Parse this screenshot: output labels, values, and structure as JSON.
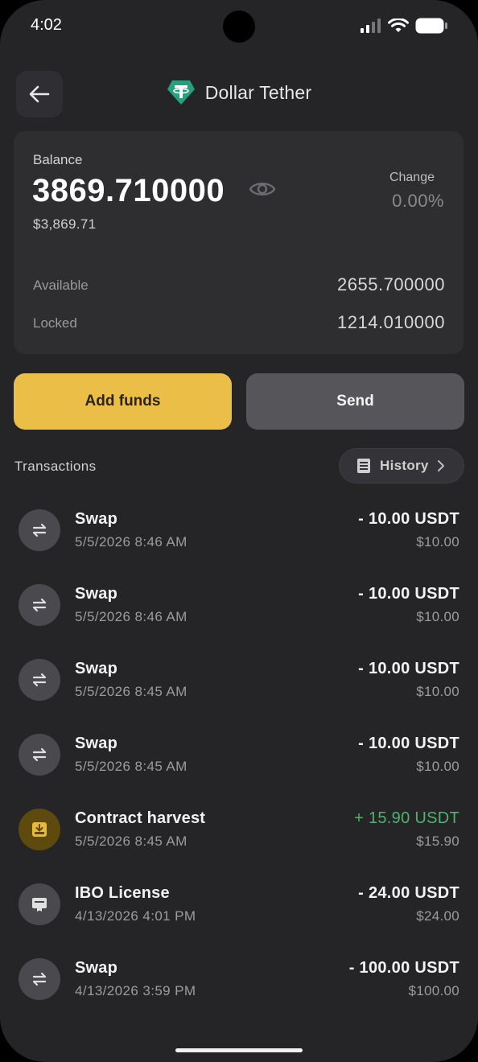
{
  "status_bar": {
    "time": "4:02"
  },
  "header": {
    "title": "Dollar Tether",
    "token_color": "#26a17b"
  },
  "balance": {
    "label": "Balance",
    "value": "3869.710000",
    "fiat": "$3,869.71",
    "change_label": "Change",
    "change_value": "0.00%",
    "available_label": "Available",
    "available_value": "2655.700000",
    "locked_label": "Locked",
    "locked_value": "1214.010000"
  },
  "actions": {
    "add_funds": "Add funds",
    "send": "Send",
    "accent": "#ebbe47"
  },
  "transactions": {
    "heading": "Transactions",
    "history_label": "History",
    "items": [
      {
        "title": "Swap",
        "date": "5/5/2026 8:46 AM",
        "amount": "- 10.00 USDT",
        "fiat": "$10.00",
        "icon": "swap-icon"
      },
      {
        "title": "Swap",
        "date": "5/5/2026 8:46 AM",
        "amount": "- 10.00 USDT",
        "fiat": "$10.00",
        "icon": "swap-icon"
      },
      {
        "title": "Swap",
        "date": "5/5/2026 8:45 AM",
        "amount": "- 10.00 USDT",
        "fiat": "$10.00",
        "icon": "swap-icon"
      },
      {
        "title": "Swap",
        "date": "5/5/2026 8:45 AM",
        "amount": "- 10.00 USDT",
        "fiat": "$10.00",
        "icon": "swap-icon"
      },
      {
        "title": "Contract harvest",
        "date": "5/5/2026 8:45 AM",
        "amount": "+ 15.90 USDT",
        "fiat": "$15.90",
        "icon": "harvest-icon"
      },
      {
        "title": "IBO License",
        "date": "4/13/2026 4:01 PM",
        "amount": "- 24.00 USDT",
        "fiat": "$24.00",
        "icon": "license-icon"
      },
      {
        "title": "Swap",
        "date": "4/13/2026 3:59 PM",
        "amount": "- 100.00 USDT",
        "fiat": "$100.00",
        "icon": "swap-icon"
      }
    ],
    "positive_color": "#4cb56a"
  }
}
